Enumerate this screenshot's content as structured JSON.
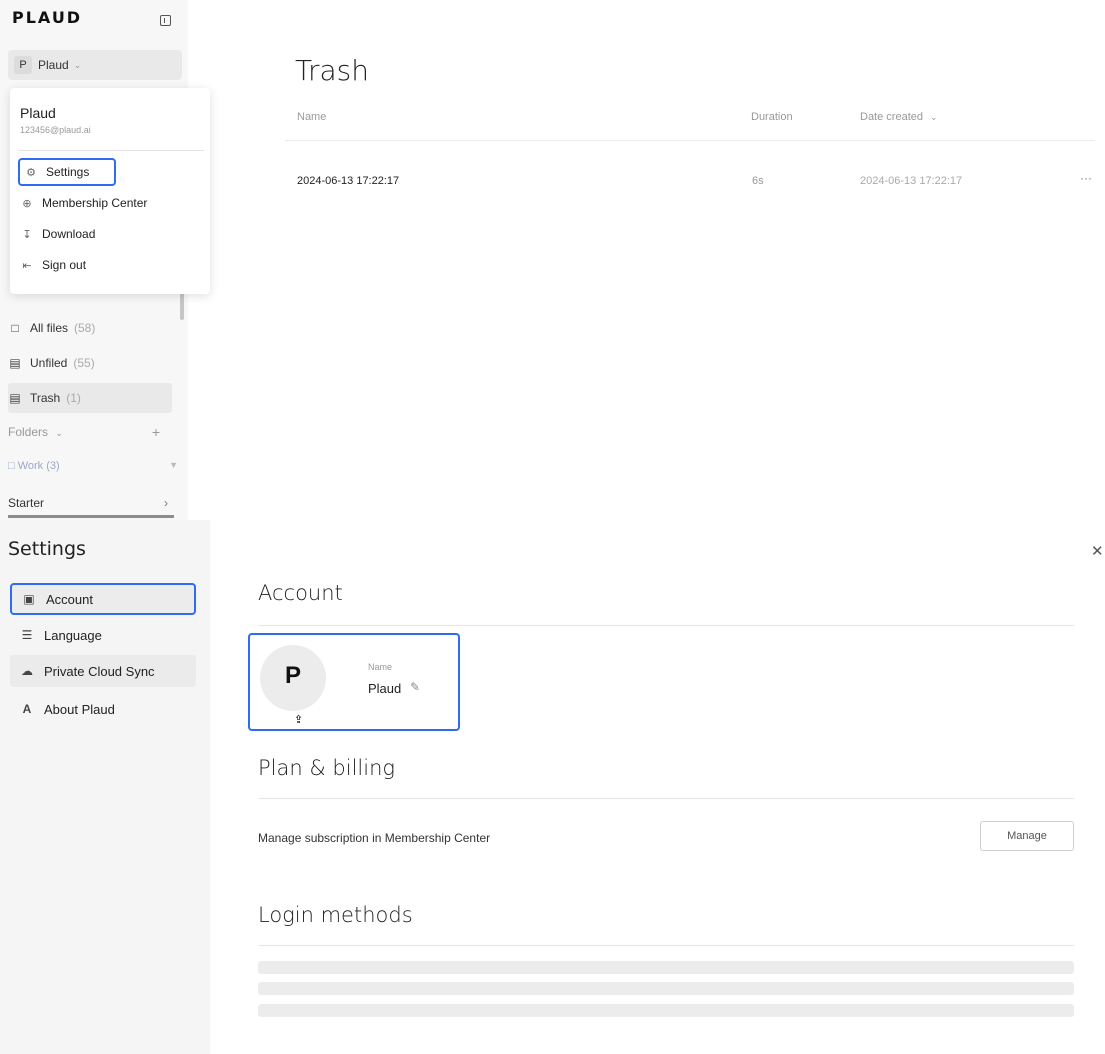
{
  "app": {
    "logo": "PLAUD"
  },
  "user_switcher": {
    "avatar_letter": "P",
    "name": "Plaud"
  },
  "user_menu": {
    "name": "Plaud",
    "email": "123456@plaud.ai",
    "items": [
      {
        "label": "Settings"
      },
      {
        "label": "Membership Center"
      },
      {
        "label": "Download"
      },
      {
        "label": "Sign out"
      }
    ]
  },
  "sidebar": {
    "all_files": {
      "label": "All files",
      "count": "(58)"
    },
    "unfiled": {
      "label": "Unfiled",
      "count": "(55)"
    },
    "trash": {
      "label": "Trash",
      "count": "(1)"
    },
    "folders_label": "Folders",
    "work": {
      "label": "Work",
      "count": "(3)"
    },
    "starter": "Starter"
  },
  "trash_page": {
    "title": "Trash",
    "columns": [
      "Name",
      "Duration",
      "Date created"
    ],
    "rows": [
      {
        "name": "2024-06-13 17:22:17",
        "duration": "6s",
        "date_created": "2024-06-13 17:22:17"
      }
    ]
  },
  "settings": {
    "title": "Settings",
    "nav": [
      {
        "label": "Account"
      },
      {
        "label": "Language"
      },
      {
        "label": "Private Cloud Sync"
      },
      {
        "label": "About Plaud"
      }
    ],
    "account": {
      "title": "Account",
      "avatar_letter": "P",
      "name_label": "Name",
      "name_value": "Plaud"
    },
    "plan": {
      "title": "Plan & billing",
      "description": "Manage subscription in Membership Center",
      "button": "Manage"
    },
    "login": {
      "title": "Login methods"
    }
  },
  "colors": {
    "highlight_border": "#2f6bf5",
    "sidebar_bg": "#f7f7f7"
  }
}
